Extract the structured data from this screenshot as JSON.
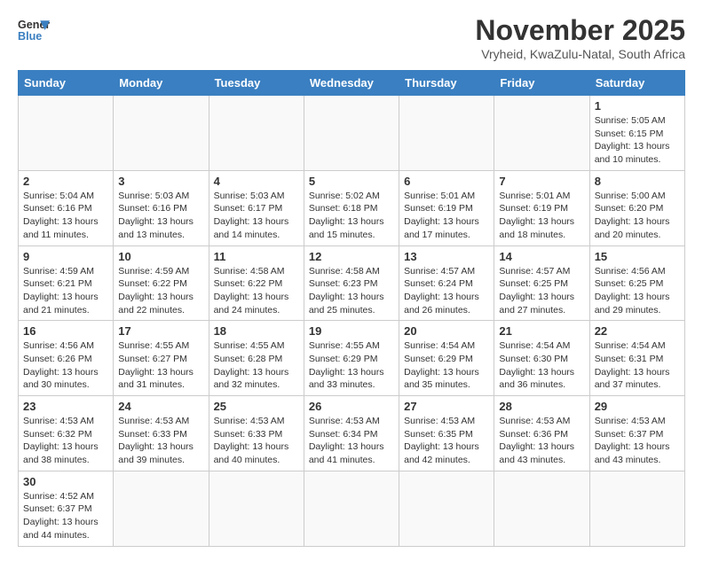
{
  "logo": {
    "line1": "General",
    "line2": "Blue"
  },
  "title": "November 2025",
  "subtitle": "Vryheid, KwaZulu-Natal, South Africa",
  "weekdays": [
    "Sunday",
    "Monday",
    "Tuesday",
    "Wednesday",
    "Thursday",
    "Friday",
    "Saturday"
  ],
  "weeks": [
    [
      {
        "day": "",
        "info": ""
      },
      {
        "day": "",
        "info": ""
      },
      {
        "day": "",
        "info": ""
      },
      {
        "day": "",
        "info": ""
      },
      {
        "day": "",
        "info": ""
      },
      {
        "day": "",
        "info": ""
      },
      {
        "day": "1",
        "info": "Sunrise: 5:05 AM\nSunset: 6:15 PM\nDaylight: 13 hours and 10 minutes."
      }
    ],
    [
      {
        "day": "2",
        "info": "Sunrise: 5:04 AM\nSunset: 6:16 PM\nDaylight: 13 hours and 11 minutes."
      },
      {
        "day": "3",
        "info": "Sunrise: 5:03 AM\nSunset: 6:16 PM\nDaylight: 13 hours and 13 minutes."
      },
      {
        "day": "4",
        "info": "Sunrise: 5:03 AM\nSunset: 6:17 PM\nDaylight: 13 hours and 14 minutes."
      },
      {
        "day": "5",
        "info": "Sunrise: 5:02 AM\nSunset: 6:18 PM\nDaylight: 13 hours and 15 minutes."
      },
      {
        "day": "6",
        "info": "Sunrise: 5:01 AM\nSunset: 6:19 PM\nDaylight: 13 hours and 17 minutes."
      },
      {
        "day": "7",
        "info": "Sunrise: 5:01 AM\nSunset: 6:19 PM\nDaylight: 13 hours and 18 minutes."
      },
      {
        "day": "8",
        "info": "Sunrise: 5:00 AM\nSunset: 6:20 PM\nDaylight: 13 hours and 20 minutes."
      }
    ],
    [
      {
        "day": "9",
        "info": "Sunrise: 4:59 AM\nSunset: 6:21 PM\nDaylight: 13 hours and 21 minutes."
      },
      {
        "day": "10",
        "info": "Sunrise: 4:59 AM\nSunset: 6:22 PM\nDaylight: 13 hours and 22 minutes."
      },
      {
        "day": "11",
        "info": "Sunrise: 4:58 AM\nSunset: 6:22 PM\nDaylight: 13 hours and 24 minutes."
      },
      {
        "day": "12",
        "info": "Sunrise: 4:58 AM\nSunset: 6:23 PM\nDaylight: 13 hours and 25 minutes."
      },
      {
        "day": "13",
        "info": "Sunrise: 4:57 AM\nSunset: 6:24 PM\nDaylight: 13 hours and 26 minutes."
      },
      {
        "day": "14",
        "info": "Sunrise: 4:57 AM\nSunset: 6:25 PM\nDaylight: 13 hours and 27 minutes."
      },
      {
        "day": "15",
        "info": "Sunrise: 4:56 AM\nSunset: 6:25 PM\nDaylight: 13 hours and 29 minutes."
      }
    ],
    [
      {
        "day": "16",
        "info": "Sunrise: 4:56 AM\nSunset: 6:26 PM\nDaylight: 13 hours and 30 minutes."
      },
      {
        "day": "17",
        "info": "Sunrise: 4:55 AM\nSunset: 6:27 PM\nDaylight: 13 hours and 31 minutes."
      },
      {
        "day": "18",
        "info": "Sunrise: 4:55 AM\nSunset: 6:28 PM\nDaylight: 13 hours and 32 minutes."
      },
      {
        "day": "19",
        "info": "Sunrise: 4:55 AM\nSunset: 6:29 PM\nDaylight: 13 hours and 33 minutes."
      },
      {
        "day": "20",
        "info": "Sunrise: 4:54 AM\nSunset: 6:29 PM\nDaylight: 13 hours and 35 minutes."
      },
      {
        "day": "21",
        "info": "Sunrise: 4:54 AM\nSunset: 6:30 PM\nDaylight: 13 hours and 36 minutes."
      },
      {
        "day": "22",
        "info": "Sunrise: 4:54 AM\nSunset: 6:31 PM\nDaylight: 13 hours and 37 minutes."
      }
    ],
    [
      {
        "day": "23",
        "info": "Sunrise: 4:53 AM\nSunset: 6:32 PM\nDaylight: 13 hours and 38 minutes."
      },
      {
        "day": "24",
        "info": "Sunrise: 4:53 AM\nSunset: 6:33 PM\nDaylight: 13 hours and 39 minutes."
      },
      {
        "day": "25",
        "info": "Sunrise: 4:53 AM\nSunset: 6:33 PM\nDaylight: 13 hours and 40 minutes."
      },
      {
        "day": "26",
        "info": "Sunrise: 4:53 AM\nSunset: 6:34 PM\nDaylight: 13 hours and 41 minutes."
      },
      {
        "day": "27",
        "info": "Sunrise: 4:53 AM\nSunset: 6:35 PM\nDaylight: 13 hours and 42 minutes."
      },
      {
        "day": "28",
        "info": "Sunrise: 4:53 AM\nSunset: 6:36 PM\nDaylight: 13 hours and 43 minutes."
      },
      {
        "day": "29",
        "info": "Sunrise: 4:53 AM\nSunset: 6:37 PM\nDaylight: 13 hours and 43 minutes."
      }
    ],
    [
      {
        "day": "30",
        "info": "Sunrise: 4:52 AM\nSunset: 6:37 PM\nDaylight: 13 hours and 44 minutes."
      },
      {
        "day": "",
        "info": ""
      },
      {
        "day": "",
        "info": ""
      },
      {
        "day": "",
        "info": ""
      },
      {
        "day": "",
        "info": ""
      },
      {
        "day": "",
        "info": ""
      },
      {
        "day": "",
        "info": ""
      }
    ]
  ]
}
